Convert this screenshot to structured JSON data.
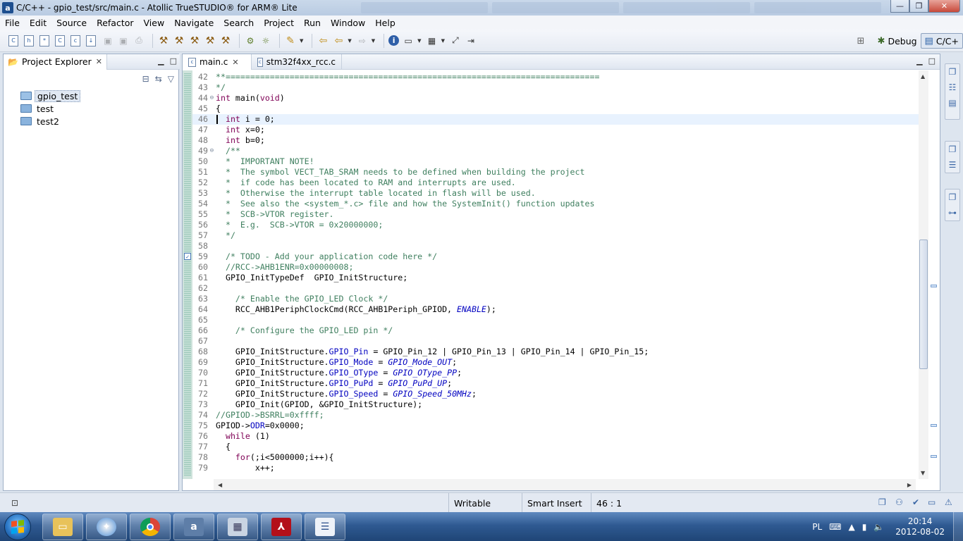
{
  "window": {
    "title": "C/C++ - gpio_test/src/main.c - Atollic TrueSTUDIO® for ARM® Lite",
    "app_icon_glyph": "a",
    "minimize_glyph": "—",
    "maximize_glyph": "❐",
    "close_glyph": "✕"
  },
  "menu": [
    "File",
    "Edit",
    "Source",
    "Refactor",
    "View",
    "Navigate",
    "Search",
    "Project",
    "Run",
    "Window",
    "Help"
  ],
  "perspectives": {
    "debug_label": "Debug",
    "cpp_label": "C/C+"
  },
  "project_explorer": {
    "tab_label": "Project Explorer",
    "items": [
      {
        "label": "gpio_test",
        "type": "project",
        "selected": true
      },
      {
        "label": "test",
        "type": "folder",
        "selected": false
      },
      {
        "label": "test2",
        "type": "folder",
        "selected": false
      }
    ]
  },
  "editor": {
    "tabs": [
      {
        "label": "main.c",
        "active": true
      },
      {
        "label": "stm32f4xx_rcc.c",
        "active": false
      }
    ],
    "lines": [
      {
        "n": "42",
        "segs": [
          {
            "t": "**============================================================================",
            "c": "comment"
          }
        ]
      },
      {
        "n": "43",
        "segs": [
          {
            "t": "*/",
            "c": "comment"
          }
        ]
      },
      {
        "n": "44",
        "fold": "⊖",
        "segs": [
          {
            "t": "int",
            "c": "kw"
          },
          {
            "t": " main(",
            "c": ""
          },
          {
            "t": "void",
            "c": "kw"
          },
          {
            "t": ")",
            "c": ""
          }
        ]
      },
      {
        "n": "45",
        "segs": [
          {
            "t": "{",
            "c": ""
          }
        ]
      },
      {
        "n": "46",
        "cur": true,
        "segs": [
          {
            "t": "  ",
            "c": ""
          },
          {
            "t": "int",
            "c": "kw"
          },
          {
            "t": " i = 0;",
            "c": ""
          }
        ]
      },
      {
        "n": "47",
        "segs": [
          {
            "t": "  ",
            "c": ""
          },
          {
            "t": "int",
            "c": "kw"
          },
          {
            "t": " x=0;",
            "c": ""
          }
        ]
      },
      {
        "n": "48",
        "segs": [
          {
            "t": "  ",
            "c": ""
          },
          {
            "t": "int",
            "c": "kw"
          },
          {
            "t": " b=0;",
            "c": ""
          }
        ]
      },
      {
        "n": "49",
        "fold": "⊖",
        "segs": [
          {
            "t": "  /**",
            "c": "comment"
          }
        ]
      },
      {
        "n": "50",
        "segs": [
          {
            "t": "  *  IMPORTANT NOTE!",
            "c": "comment"
          }
        ]
      },
      {
        "n": "51",
        "segs": [
          {
            "t": "  *  The symbol VECT_TAB_SRAM needs to be defined when building the project",
            "c": "comment"
          }
        ]
      },
      {
        "n": "52",
        "segs": [
          {
            "t": "  *  if code has been located to RAM and interrupts are used.",
            "c": "comment"
          }
        ]
      },
      {
        "n": "53",
        "segs": [
          {
            "t": "  *  Otherwise the interrupt table located in flash will be used.",
            "c": "comment"
          }
        ]
      },
      {
        "n": "54",
        "segs": [
          {
            "t": "  *  See also the <system_*.c> file and how the SystemInit() function updates",
            "c": "comment"
          }
        ]
      },
      {
        "n": "55",
        "segs": [
          {
            "t": "  *  SCB->VTOR register.",
            "c": "comment"
          }
        ]
      },
      {
        "n": "56",
        "segs": [
          {
            "t": "  *  E.g.  SCB->VTOR = 0x20000000;",
            "c": "comment"
          }
        ]
      },
      {
        "n": "57",
        "segs": [
          {
            "t": "  */",
            "c": "comment"
          }
        ]
      },
      {
        "n": "58",
        "segs": [
          {
            "t": "",
            "c": ""
          }
        ]
      },
      {
        "n": "59",
        "task": true,
        "segs": [
          {
            "t": "  /* TODO - Add your application code here */",
            "c": "comment"
          }
        ]
      },
      {
        "n": "60",
        "segs": [
          {
            "t": "  //RCC->AHB1ENR=0x00000008;",
            "c": "comment"
          }
        ]
      },
      {
        "n": "61",
        "segs": [
          {
            "t": "  GPIO_InitTypeDef  GPIO_InitStructure;",
            "c": ""
          }
        ]
      },
      {
        "n": "62",
        "segs": [
          {
            "t": "",
            "c": ""
          }
        ]
      },
      {
        "n": "63",
        "segs": [
          {
            "t": "    /* Enable the GPIO_LED Clock */",
            "c": "comment"
          }
        ]
      },
      {
        "n": "64",
        "segs": [
          {
            "t": "    RCC_AHB1PeriphClockCmd(RCC_AHB1Periph_GPIOD, ",
            "c": ""
          },
          {
            "t": "ENABLE",
            "c": "it"
          },
          {
            "t": ");",
            "c": ""
          }
        ]
      },
      {
        "n": "65",
        "segs": [
          {
            "t": "",
            "c": ""
          }
        ]
      },
      {
        "n": "66",
        "segs": [
          {
            "t": "    /* Configure the GPIO_LED pin */",
            "c": "comment"
          }
        ]
      },
      {
        "n": "67",
        "segs": [
          {
            "t": "",
            "c": ""
          }
        ]
      },
      {
        "n": "68",
        "segs": [
          {
            "t": "    GPIO_InitStructure.",
            "c": ""
          },
          {
            "t": "GPIO_Pin",
            "c": "f"
          },
          {
            "t": " = GPIO_Pin_12 | GPIO_Pin_13 | GPIO_Pin_14 | GPIO_Pin_15;",
            "c": ""
          }
        ]
      },
      {
        "n": "69",
        "segs": [
          {
            "t": "    GPIO_InitStructure.",
            "c": ""
          },
          {
            "t": "GPIO_Mode",
            "c": "f"
          },
          {
            "t": " = ",
            "c": ""
          },
          {
            "t": "GPIO_Mode_OUT",
            "c": "it"
          },
          {
            "t": ";",
            "c": ""
          }
        ]
      },
      {
        "n": "70",
        "segs": [
          {
            "t": "    GPIO_InitStructure.",
            "c": ""
          },
          {
            "t": "GPIO_OType",
            "c": "f"
          },
          {
            "t": " = ",
            "c": ""
          },
          {
            "t": "GPIO_OType_PP",
            "c": "it"
          },
          {
            "t": ";",
            "c": ""
          }
        ]
      },
      {
        "n": "71",
        "segs": [
          {
            "t": "    GPIO_InitStructure.",
            "c": ""
          },
          {
            "t": "GPIO_PuPd",
            "c": "f"
          },
          {
            "t": " = ",
            "c": ""
          },
          {
            "t": "GPIO_PuPd_UP",
            "c": "it"
          },
          {
            "t": ";",
            "c": ""
          }
        ]
      },
      {
        "n": "72",
        "segs": [
          {
            "t": "    GPIO_InitStructure.",
            "c": ""
          },
          {
            "t": "GPIO_Speed",
            "c": "f"
          },
          {
            "t": " = ",
            "c": ""
          },
          {
            "t": "GPIO_Speed_50MHz",
            "c": "it"
          },
          {
            "t": ";",
            "c": ""
          }
        ]
      },
      {
        "n": "73",
        "segs": [
          {
            "t": "    GPIO_Init(GPIOD, &GPIO_InitStructure);",
            "c": ""
          }
        ]
      },
      {
        "n": "74",
        "segs": [
          {
            "t": "//GPIOD->BSRRL=0xffff;",
            "c": "comment"
          }
        ]
      },
      {
        "n": "75",
        "segs": [
          {
            "t": "GPIOD->",
            "c": ""
          },
          {
            "t": "ODR",
            "c": "f"
          },
          {
            "t": "=0x0000;",
            "c": ""
          }
        ]
      },
      {
        "n": "76",
        "segs": [
          {
            "t": "  ",
            "c": ""
          },
          {
            "t": "while",
            "c": "kw"
          },
          {
            "t": " (1)",
            "c": ""
          }
        ]
      },
      {
        "n": "77",
        "segs": [
          {
            "t": "  {",
            "c": ""
          }
        ]
      },
      {
        "n": "78",
        "segs": [
          {
            "t": "    ",
            "c": ""
          },
          {
            "t": "for",
            "c": "kw"
          },
          {
            "t": "(;i<5000000;i++){",
            "c": ""
          }
        ]
      },
      {
        "n": "79",
        "segs": [
          {
            "t": "        x++;",
            "c": ""
          }
        ]
      }
    ]
  },
  "status": {
    "writable": "Writable",
    "insert_mode": "Smart Insert",
    "position": "46 : 1"
  },
  "taskbar": {
    "lang": "PL",
    "time": "20:14",
    "date": "2012-08-02"
  },
  "colors": {
    "keyword": "#7f0055",
    "comment": "#3f7f5f",
    "field": "#0000c0",
    "current_line": "#e8f2fe"
  }
}
